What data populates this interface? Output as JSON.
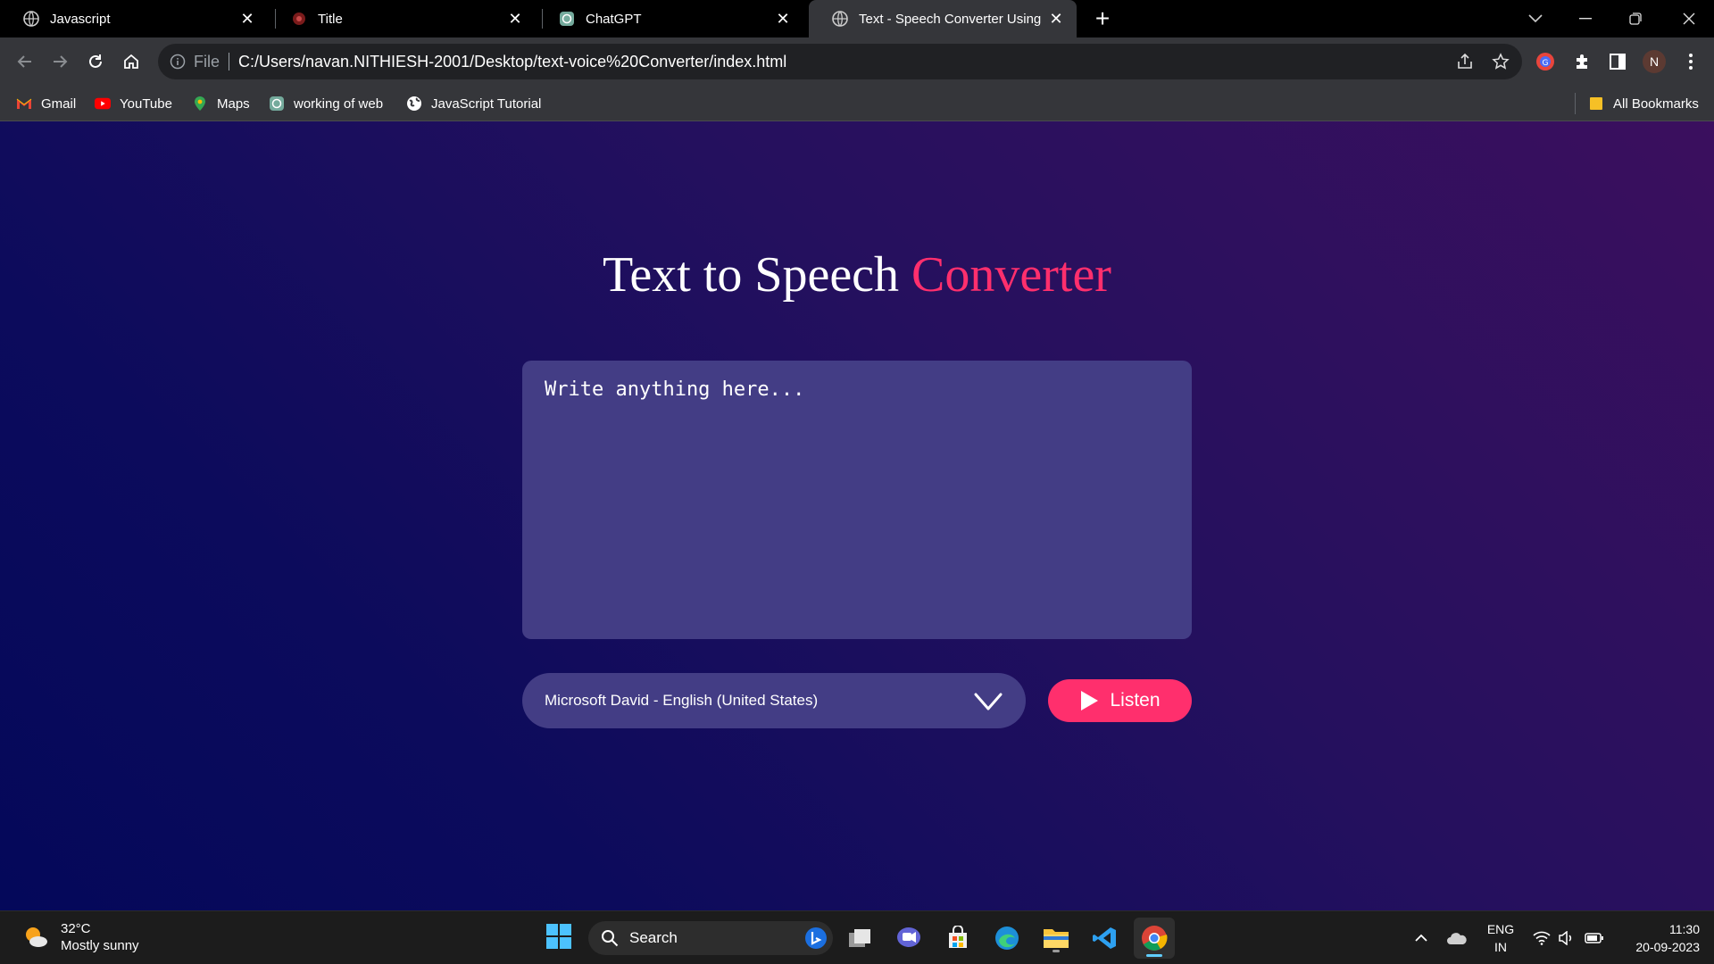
{
  "browser": {
    "tabs": [
      {
        "title": "Javascript",
        "icon": "globe-icon",
        "active": false
      },
      {
        "title": "Title",
        "icon": "page-favicon-icon",
        "active": false
      },
      {
        "title": "ChatGPT",
        "icon": "chatgpt-icon",
        "active": false
      },
      {
        "title": "Text - Speech Converter Using ja",
        "icon": "globe-icon",
        "active": true
      }
    ],
    "omnibox": {
      "scheme_label": "File",
      "url": "C:/Users/navan.NITHIESH-2001/Desktop/text-voice%20Converter/index.html"
    },
    "profile_initial": "N",
    "bookmarks": [
      {
        "label": "Gmail",
        "icon": "gmail-icon"
      },
      {
        "label": "YouTube",
        "icon": "youtube-icon"
      },
      {
        "label": "Maps",
        "icon": "maps-icon"
      },
      {
        "label": "working of web",
        "icon": "chatgpt-icon"
      },
      {
        "label": "JavaScript Tutorial",
        "icon": "globe-icon"
      }
    ],
    "all_bookmarks_label": "All Bookmarks"
  },
  "page": {
    "heading_main": "Text to Speech",
    "heading_accent": "Converter",
    "textarea_placeholder": "Write anything here...",
    "voice_select_value": "Microsoft David - English (United States)",
    "listen_label": "Listen",
    "colors": {
      "accent": "#ff2f6d",
      "panel": "#433d85",
      "bg_start": "#04085a",
      "bg_end": "#3b0f5e"
    }
  },
  "taskbar": {
    "weather_temp": "32°C",
    "weather_desc": "Mostly sunny",
    "search_label": "Search",
    "lang_top": "ENG",
    "lang_bottom": "IN",
    "time": "11:30",
    "date": "20-09-2023"
  }
}
